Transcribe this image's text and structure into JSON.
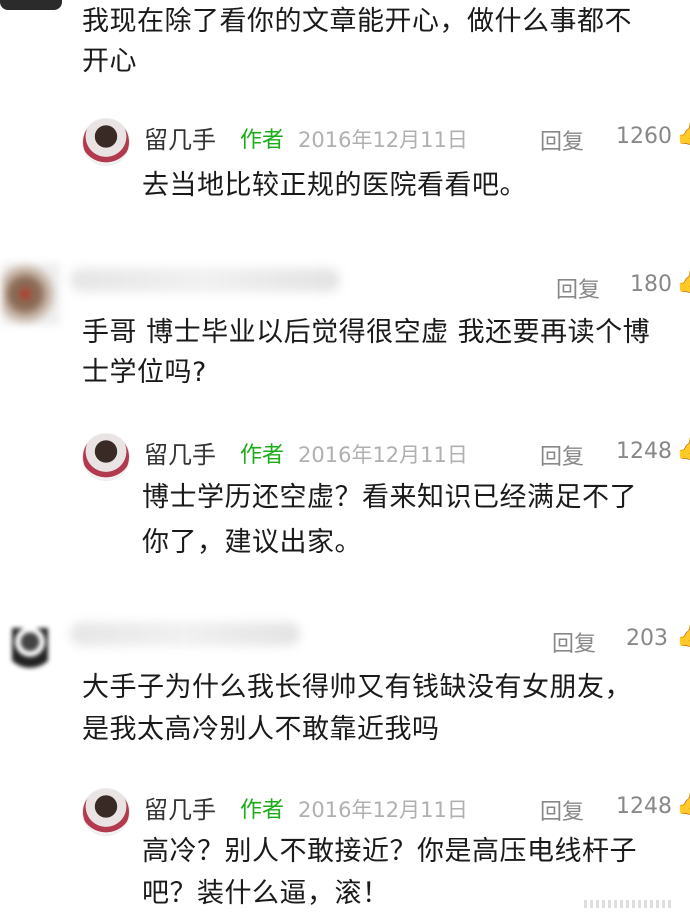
{
  "top_comment": {
    "text_line1": "我现在除了看你的文章能开心，做什么事都不",
    "text_line2": "开心"
  },
  "reply1": {
    "author": "留几手",
    "tag": "作者",
    "date": "2016年12月11日",
    "reply_label": "回复",
    "likes": "1260",
    "text": "去当地比较正规的医院看看吧。"
  },
  "comment2": {
    "reply_label": "回复",
    "likes": "180",
    "text_line1": "手哥 博士毕业以后觉得很空虚 我还要再读个博",
    "text_line2": "士学位吗?"
  },
  "reply2": {
    "author": "留几手",
    "tag": "作者",
    "date": "2016年12月11日",
    "reply_label": "回复",
    "likes": "1248",
    "text_line1": "博士学历还空虚？看来知识已经满足不了",
    "text_line2": "你了，建议出家。"
  },
  "comment3": {
    "reply_label": "回复",
    "likes": "203",
    "text_line1": "大手子为什么我长得帅又有钱缺没有女朋友，",
    "text_line2": "是我太高冷别人不敢靠近我吗"
  },
  "reply3": {
    "author": "留几手",
    "tag": "作者",
    "date": "2016年12月11日",
    "reply_label": "回复",
    "likes": "1248",
    "text_line1": "高冷？别人不敢接近？你是高压电线杆子",
    "text_line2": "吧？装什么逼，滚！"
  },
  "icons": {
    "like": "thumbs-up-icon",
    "avatar": "user-avatar"
  },
  "colors": {
    "author_tag": "#1aad19",
    "date": "#b0b0b0",
    "meta": "#888888"
  }
}
